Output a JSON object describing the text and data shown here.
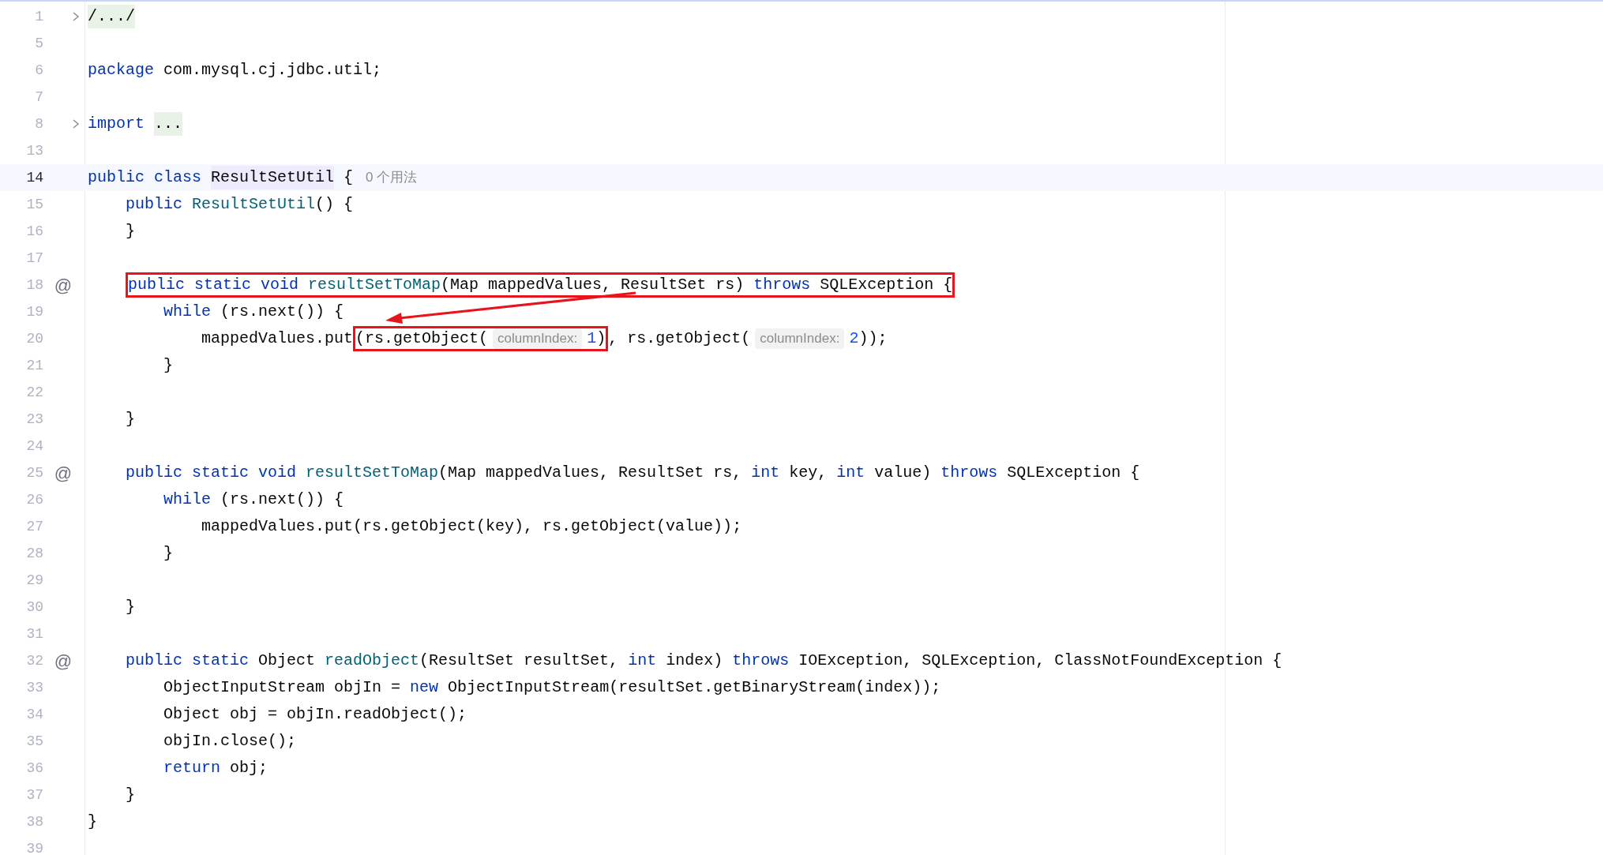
{
  "editor": {
    "lines": [
      {
        "number": "1",
        "fold": true,
        "segments": [
          {
            "kind": "fold",
            "text": "/.../"
          }
        ]
      },
      {
        "number": "5"
      },
      {
        "number": "6",
        "segments": [
          {
            "kind": "kw",
            "text": "package"
          },
          {
            "kind": "tx",
            "text": " com.mysql.cj.jdbc.util;"
          }
        ]
      },
      {
        "number": "7"
      },
      {
        "number": "8",
        "fold": true,
        "segments": [
          {
            "kind": "kw",
            "text": "import "
          },
          {
            "kind": "fold",
            "text": "..."
          }
        ]
      },
      {
        "number": "13"
      },
      {
        "number": "14",
        "current": true,
        "segments": [
          {
            "kind": "kw",
            "text": "public class "
          },
          {
            "kind": "cls",
            "text": "ResultSetUtil"
          },
          {
            "kind": "tx",
            "text": " {"
          },
          {
            "kind": "usage",
            "text": "0 个用法"
          }
        ]
      },
      {
        "number": "15",
        "segments": [
          {
            "kind": "kw",
            "text": "    public "
          },
          {
            "kind": "fn",
            "text": "ResultSetUtil"
          },
          {
            "kind": "tx",
            "text": "() {"
          }
        ]
      },
      {
        "number": "16",
        "segments": [
          {
            "kind": "tx",
            "text": "    }"
          }
        ]
      },
      {
        "number": "17"
      },
      {
        "number": "18",
        "gutter_icon": "@",
        "segments": [
          {
            "kind": "kw",
            "text": "    public static void ",
            "boxed": true
          },
          {
            "kind": "fn",
            "text": "resultSetToMap",
            "boxed": true
          },
          {
            "kind": "tx",
            "text": "(Map mappedValues, ResultSet rs) ",
            "boxed": true
          },
          {
            "kind": "kw",
            "text": "throws",
            "boxed": true
          },
          {
            "kind": "tx",
            "text": " SQLException {",
            "boxed": true
          }
        ]
      },
      {
        "number": "19",
        "segments": [
          {
            "kind": "kw",
            "text": "        while"
          },
          {
            "kind": "tx",
            "text": " (rs.next()) {"
          }
        ]
      },
      {
        "number": "20",
        "segments": [
          {
            "kind": "tx",
            "text": "            mappedValues.put"
          },
          {
            "kind": "tx",
            "text": "(rs.getObject(",
            "boxed": true
          },
          {
            "kind": "hint",
            "text": "columnIndex:",
            "boxed": true
          },
          {
            "kind": "num",
            "text": "1",
            "boxed": true
          },
          {
            "kind": "tx",
            "text": ")",
            "boxed": true
          },
          {
            "kind": "tx",
            "text": ", rs.getObject("
          },
          {
            "kind": "hint",
            "text": "columnIndex:"
          },
          {
            "kind": "num",
            "text": "2"
          },
          {
            "kind": "tx",
            "text": "));"
          }
        ]
      },
      {
        "number": "21",
        "segments": [
          {
            "kind": "tx",
            "text": "        }"
          }
        ]
      },
      {
        "number": "22"
      },
      {
        "number": "23",
        "segments": [
          {
            "kind": "tx",
            "text": "    }"
          }
        ]
      },
      {
        "number": "24"
      },
      {
        "number": "25",
        "gutter_icon": "@",
        "segments": [
          {
            "kind": "kw",
            "text": "    public static void "
          },
          {
            "kind": "fn",
            "text": "resultSetToMap"
          },
          {
            "kind": "tx",
            "text": "(Map mappedValues, ResultSet rs, "
          },
          {
            "kind": "kw",
            "text": "int"
          },
          {
            "kind": "tx",
            "text": " key, "
          },
          {
            "kind": "kw",
            "text": "int"
          },
          {
            "kind": "tx",
            "text": " value) "
          },
          {
            "kind": "kw",
            "text": "throws"
          },
          {
            "kind": "tx",
            "text": " SQLException {"
          }
        ]
      },
      {
        "number": "26",
        "segments": [
          {
            "kind": "kw",
            "text": "        while"
          },
          {
            "kind": "tx",
            "text": " (rs.next()) {"
          }
        ]
      },
      {
        "number": "27",
        "segments": [
          {
            "kind": "tx",
            "text": "            mappedValues.put(rs.getObject(key), rs.getObject(value));"
          }
        ]
      },
      {
        "number": "28",
        "segments": [
          {
            "kind": "tx",
            "text": "        }"
          }
        ]
      },
      {
        "number": "29"
      },
      {
        "number": "30",
        "segments": [
          {
            "kind": "tx",
            "text": "    }"
          }
        ]
      },
      {
        "number": "31"
      },
      {
        "number": "32",
        "gutter_icon": "@",
        "segments": [
          {
            "kind": "kw",
            "text": "    public static"
          },
          {
            "kind": "tx",
            "text": " Object "
          },
          {
            "kind": "fn",
            "text": "readObject"
          },
          {
            "kind": "tx",
            "text": "(ResultSet resultSet, "
          },
          {
            "kind": "kw",
            "text": "int"
          },
          {
            "kind": "tx",
            "text": " index) "
          },
          {
            "kind": "kw",
            "text": "throws"
          },
          {
            "kind": "tx",
            "text": " IOException, SQLException, ClassNotFoundException {"
          }
        ]
      },
      {
        "number": "33",
        "segments": [
          {
            "kind": "tx",
            "text": "        ObjectInputStream objIn = "
          },
          {
            "kind": "kw",
            "text": "new"
          },
          {
            "kind": "tx",
            "text": " ObjectInputStream(resultSet.getBinaryStream(index));"
          }
        ]
      },
      {
        "number": "34",
        "segments": [
          {
            "kind": "tx",
            "text": "        Object obj = objIn.readObject();"
          }
        ]
      },
      {
        "number": "35",
        "segments": [
          {
            "kind": "tx",
            "text": "        objIn.close();"
          }
        ]
      },
      {
        "number": "36",
        "segments": [
          {
            "kind": "kw",
            "text": "        return"
          },
          {
            "kind": "tx",
            "text": " obj;"
          }
        ]
      },
      {
        "number": "37",
        "segments": [
          {
            "kind": "tx",
            "text": "    }"
          }
        ]
      },
      {
        "number": "38",
        "segments": [
          {
            "kind": "tx",
            "text": "}"
          }
        ]
      },
      {
        "number": "39"
      }
    ]
  },
  "arrow": true
}
